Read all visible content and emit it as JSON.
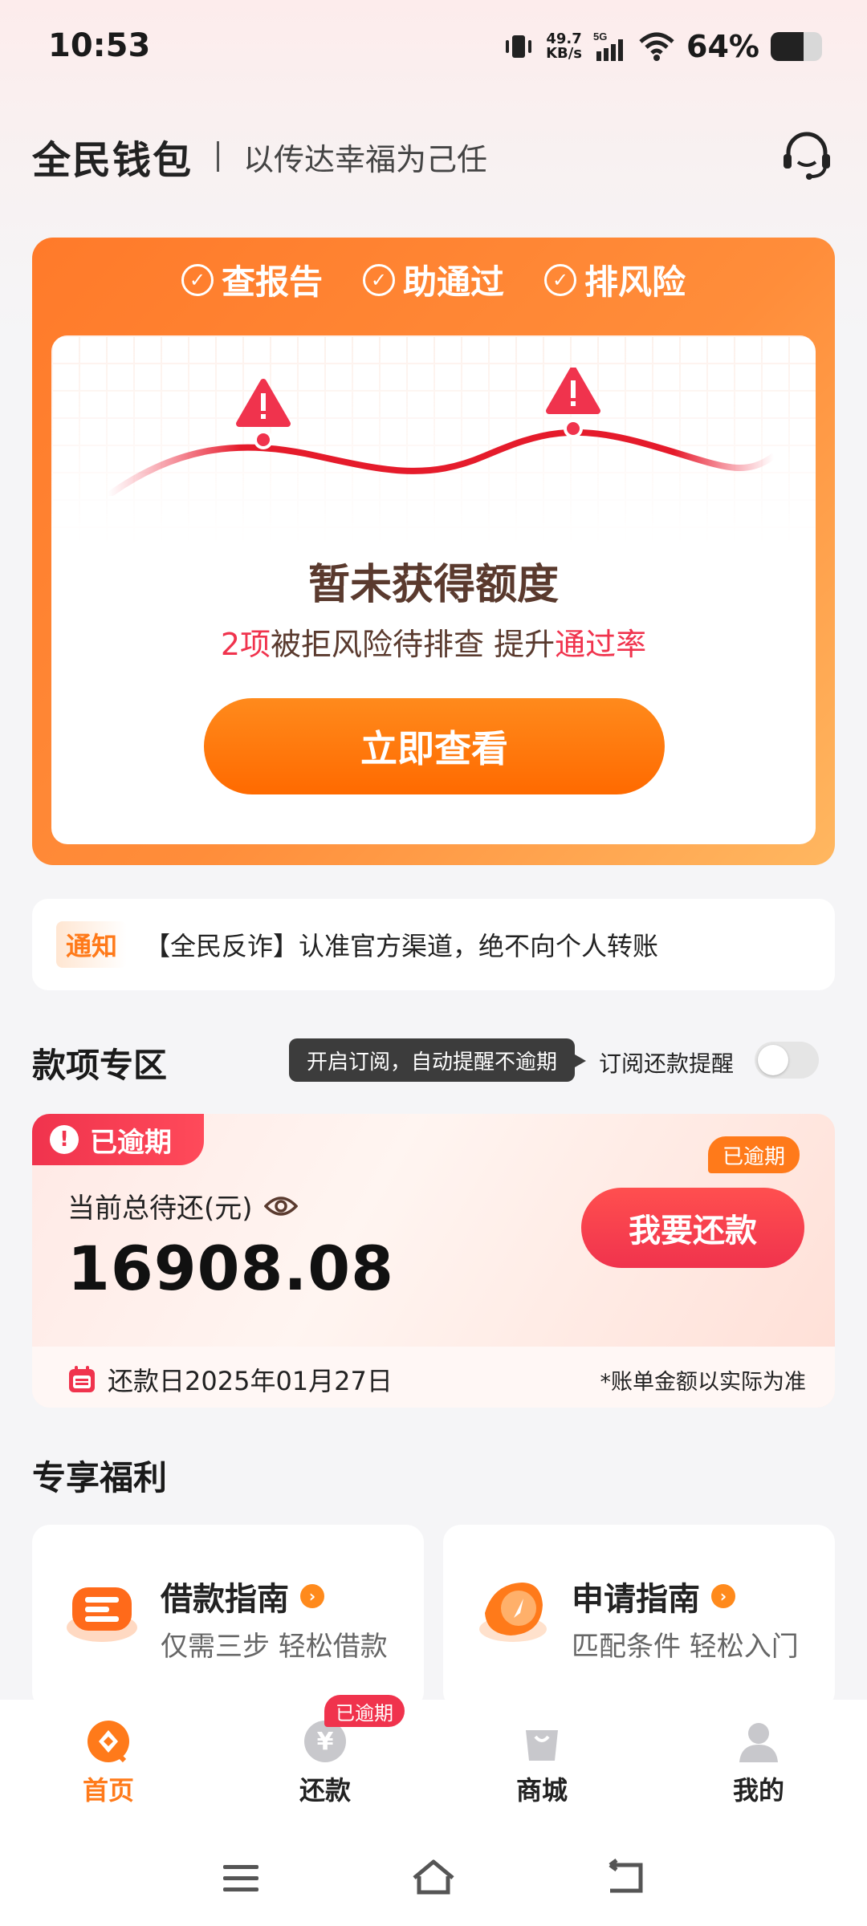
{
  "status_bar": {
    "time": "10:53",
    "net_speed_value": "49.7",
    "net_speed_unit": "KB/s",
    "network": "5G",
    "battery_percent": "64%",
    "battery_level": 0.64
  },
  "header": {
    "brand": "全民钱包",
    "slogan": "以传达幸福为己任",
    "service_icon": "headset-icon"
  },
  "credit_card": {
    "features": [
      "查报告",
      "助通过",
      "排风险"
    ],
    "headline": "暂未获得额度",
    "risk_count": "2项",
    "risk_text": "被拒风险待排查 提升",
    "risk_highlight": "通过率",
    "button": "立即查看"
  },
  "notice": {
    "tag": "通知",
    "text": "【全民反诈】认准官方渠道，绝不向个人转账"
  },
  "loan_section": {
    "title": "款项专区",
    "tooltip": "开启订阅，自动提醒不逾期",
    "subscribe_label": "订阅还款提醒",
    "subscribe_on": false
  },
  "loan_card": {
    "status_tag": "已逾期",
    "due_label": "当前总待还(元)",
    "amount": "16908.08",
    "repay_button": "我要还款",
    "button_tag": "已逾期",
    "due_date": "还款日2025年01月27日",
    "note": "*账单金额以实际为准"
  },
  "benefits": {
    "title": "专享福利",
    "items": [
      {
        "title": "借款指南",
        "subtitle": "仅需三步 轻松借款",
        "icon": "borrow-guide-icon"
      },
      {
        "title": "申请指南",
        "subtitle": "匹配条件 轻松入门",
        "icon": "apply-guide-icon"
      }
    ]
  },
  "bottom_nav": {
    "items": [
      {
        "label": "首页",
        "active": true
      },
      {
        "label": "还款",
        "active": false,
        "badge": "已逾期"
      },
      {
        "label": "商城",
        "active": false
      },
      {
        "label": "我的",
        "active": false
      }
    ]
  },
  "colors": {
    "accent_orange": "#ff7a1a",
    "alert_red": "#f0334d"
  }
}
